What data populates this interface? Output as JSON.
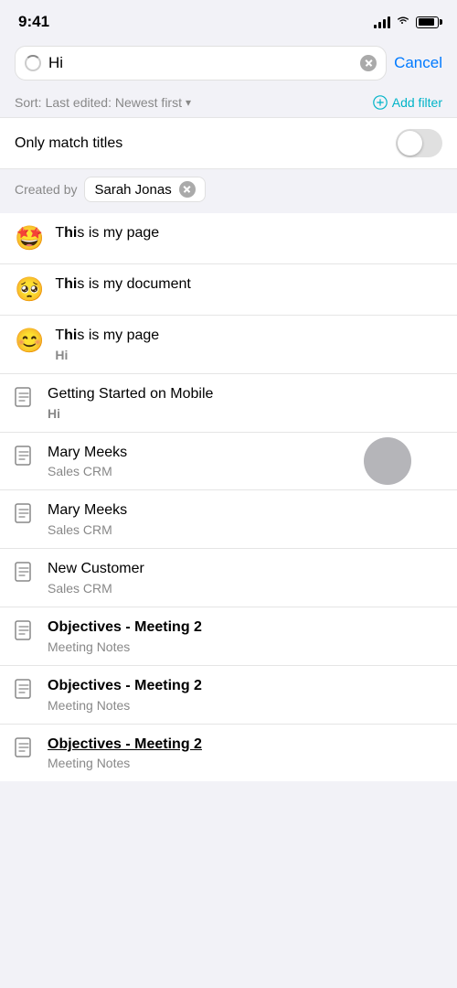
{
  "statusBar": {
    "time": "9:41"
  },
  "searchBar": {
    "query": "Hi",
    "cancelLabel": "Cancel",
    "clearAriaLabel": "clear"
  },
  "sortBar": {
    "sortLabel": "Sort:",
    "sortValue": "Last edited: Newest first",
    "addFilterLabel": "Add filter"
  },
  "toggleRow": {
    "label": "Only match titles"
  },
  "filterTag": {
    "prefixLabel": "Created by",
    "value": "Sarah Jonas"
  },
  "results": [
    {
      "id": 1,
      "iconType": "emoji",
      "icon": "🤩",
      "title": "This is my page",
      "subtitle": null,
      "titleHighlight": "Hi",
      "subtitleHighlight": null
    },
    {
      "id": 2,
      "iconType": "emoji",
      "icon": "🥺",
      "title": "This is my document",
      "subtitle": null,
      "titleHighlight": "Hi",
      "subtitleHighlight": null
    },
    {
      "id": 3,
      "iconType": "emoji",
      "icon": "😊",
      "title": "This is my page",
      "subtitle": "Hi",
      "titleHighlight": "Hi",
      "subtitleHighlight": "Hi"
    },
    {
      "id": 4,
      "iconType": "doc",
      "icon": null,
      "title": "Getting Started on Mobile",
      "subtitle": "Hi",
      "titleHighlight": null,
      "subtitleHighlight": "Hi"
    },
    {
      "id": 5,
      "iconType": "doc",
      "icon": null,
      "title": "Mary Meeks",
      "subtitle": "Sales CRM",
      "titleHighlight": null,
      "subtitleHighlight": null,
      "hasTouchIndicator": true
    },
    {
      "id": 6,
      "iconType": "doc",
      "icon": null,
      "title": "Mary Meeks",
      "subtitle": "Sales CRM",
      "titleHighlight": null,
      "subtitleHighlight": null
    },
    {
      "id": 7,
      "iconType": "doc",
      "icon": null,
      "title": "New Customer",
      "subtitle": "Sales CRM",
      "titleHighlight": null,
      "subtitleHighlight": null
    },
    {
      "id": 8,
      "iconType": "doc",
      "icon": null,
      "title": "Objectives - Meeting 2",
      "subtitle": "Meeting Notes",
      "titleHighlight": null,
      "subtitleHighlight": null
    },
    {
      "id": 9,
      "iconType": "doc",
      "icon": null,
      "title": "Objectives - Meeting 2",
      "subtitle": "Meeting Notes",
      "titleHighlight": null,
      "subtitleHighlight": null
    },
    {
      "id": 10,
      "iconType": "doc",
      "icon": null,
      "title": "Objectives - Meeting 2",
      "subtitle": "Meeting Notes",
      "titleHighlight": null,
      "subtitleHighlight": null,
      "underline": true,
      "partial": true
    }
  ]
}
